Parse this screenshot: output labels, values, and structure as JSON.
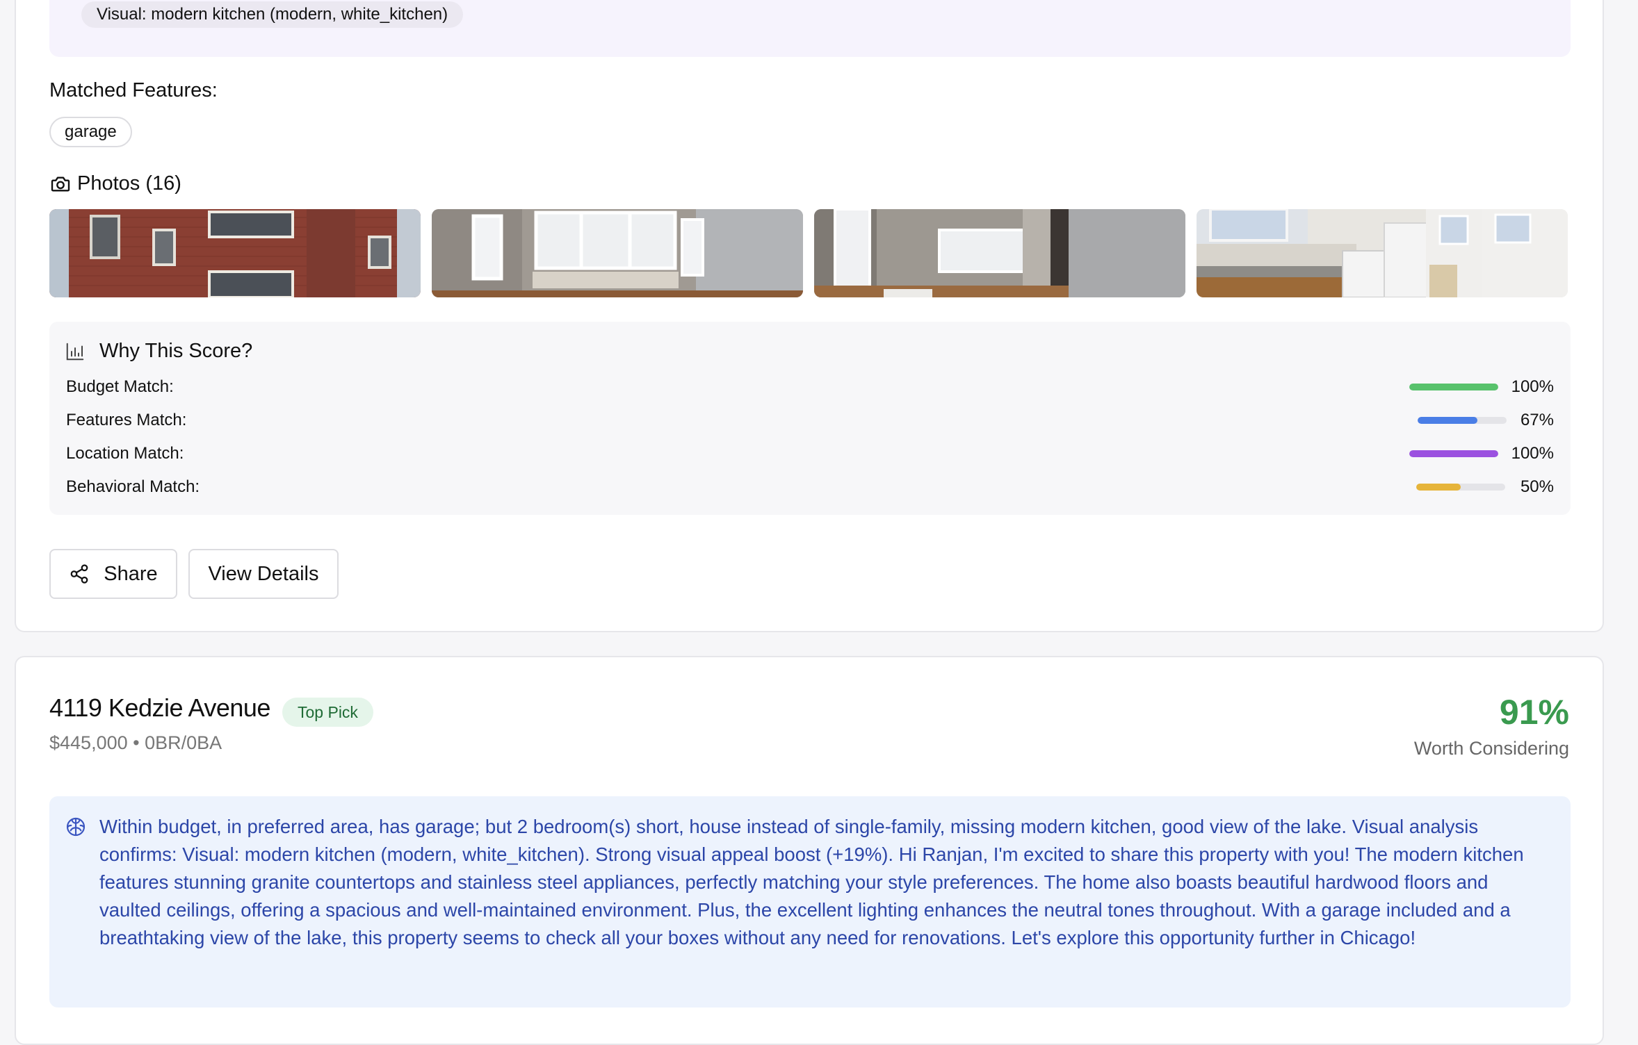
{
  "card1": {
    "visual_chip": "Visual: modern kitchen (modern, white_kitchen)",
    "matched_features_title": "Matched Features:",
    "matched_features": [
      "garage"
    ],
    "photos_title": "Photos (16)",
    "photos": [
      {
        "name": "brick-building-exterior"
      },
      {
        "name": "living-room-windows"
      },
      {
        "name": "bedroom-hardwood"
      },
      {
        "name": "kitchen-granite"
      }
    ],
    "why_score": {
      "title": "Why This Score?",
      "rows": [
        {
          "label": "Budget Match:",
          "percent": "100%",
          "value": 1.0,
          "color": "#58c26c"
        },
        {
          "label": "Features Match:",
          "percent": "67%",
          "value": 0.67,
          "color": "#4a7ee6"
        },
        {
          "label": "Location Match:",
          "percent": "100%",
          "value": 1.0,
          "color": "#9b51e0"
        },
        {
          "label": "Behavioral Match:",
          "percent": "50%",
          "value": 0.5,
          "color": "#e6b43a"
        }
      ]
    },
    "buttons": {
      "share": "Share",
      "view_details": "View Details"
    }
  },
  "card2": {
    "address": "4119 Kedzie Avenue",
    "badge": "Top Pick",
    "price_line": "$445,000 • 0BR/0BA",
    "score": "91%",
    "score_label": "Worth Considering",
    "explanation": "Within budget, in preferred area, has garage; but 2 bedroom(s) short, house instead of single-family, missing modern kitchen, good view of the lake. Visual analysis confirms: Visual: modern kitchen (modern, white_kitchen). Strong visual appeal boost (+19%). Hi Ranjan, I'm excited to share this property with you! The modern kitchen features stunning granite countertops and stainless steel appliances, perfectly matching your style preferences. The home also boasts beautiful hardwood floors and vaulted ceilings, offering a spacious and well-maintained environment. Plus, the excellent lighting enhances the neutral tones throughout. With a garage included and a breathtaking view of the lake, this property seems to check all your boxes without any need for renovations. Let's explore this opportunity further in Chicago!"
  },
  "colors": {
    "score_green": "#3a9a4f",
    "explain_blue": "#2c46a8",
    "badge_bg": "#e5f5ea"
  },
  "icons": [
    "camera-icon",
    "bar-chart-icon",
    "share-icon",
    "brain-icon"
  ]
}
